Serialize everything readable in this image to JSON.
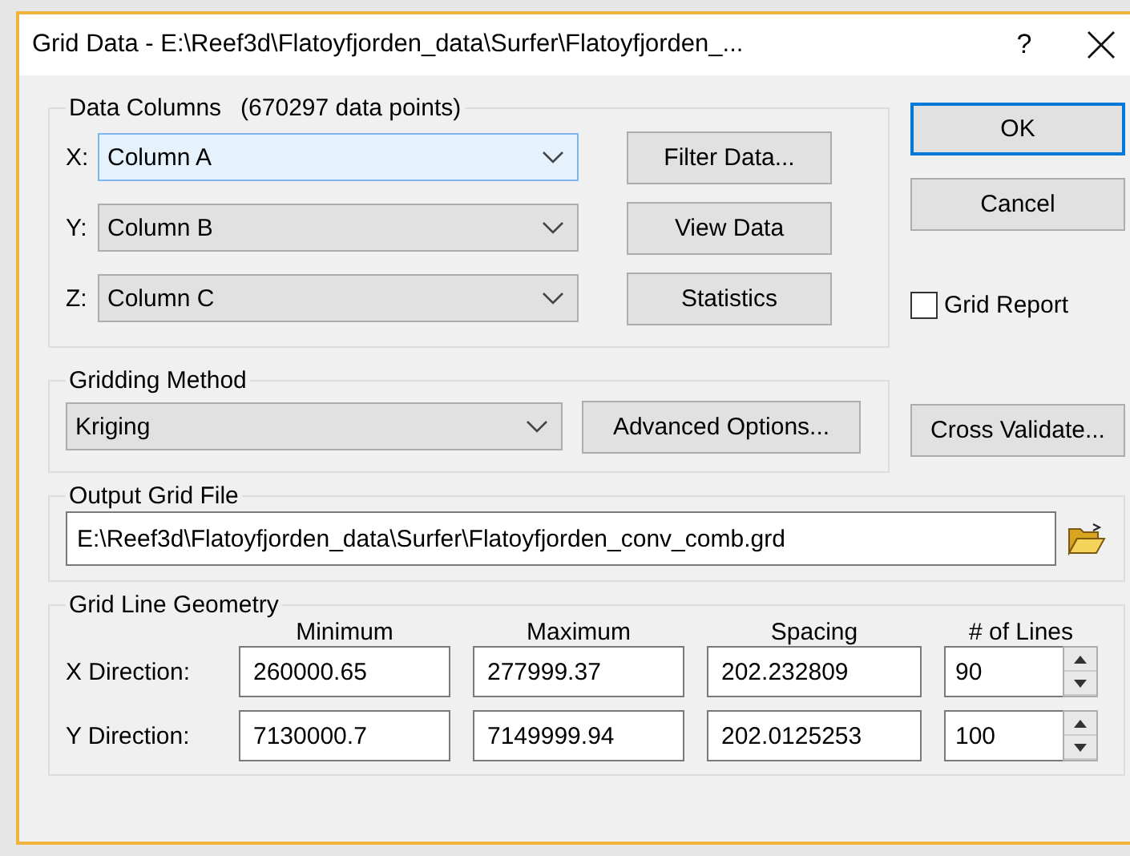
{
  "window": {
    "title": "Grid Data - E:\\Reef3d\\Flatoyfjorden_data\\Surfer\\Flatoyfjorden_...",
    "help": "?"
  },
  "data_columns": {
    "title": "Data Columns",
    "count": "(670297 data points)",
    "rows": [
      {
        "label": "X:",
        "value": "Column A",
        "focused": true
      },
      {
        "label": "Y:",
        "value": "Column B",
        "focused": false
      },
      {
        "label": "Z:",
        "value": "Column C",
        "focused": false
      }
    ],
    "buttons": [
      "Filter Data...",
      "View Data",
      "Statistics"
    ]
  },
  "side_buttons": [
    {
      "label": "OK",
      "default": true
    },
    {
      "label": "Cancel",
      "default": false
    }
  ],
  "grid_report": {
    "label": "Grid Report",
    "checked": false
  },
  "gridding_method": {
    "title": "Gridding Method",
    "value": "Kriging",
    "button": "Advanced Options..."
  },
  "cross_validate": "Cross Validate...",
  "output_grid_file": {
    "title": "Output Grid File",
    "path": "E:\\Reef3d\\Flatoyfjorden_data\\Surfer\\Flatoyfjorden_conv_comb.grd"
  },
  "grid_line_geometry": {
    "title": "Grid Line Geometry",
    "columns": [
      "Minimum",
      "Maximum",
      "Spacing",
      "# of Lines"
    ],
    "rows": [
      {
        "label": "X Direction:",
        "minimum": "260000.65",
        "maximum": "277999.37",
        "spacing": "202.232809",
        "lines": "90"
      },
      {
        "label": "Y Direction:",
        "minimum": "7130000.7",
        "maximum": "7149999.94",
        "spacing": "202.0125253",
        "lines": "100"
      }
    ]
  }
}
